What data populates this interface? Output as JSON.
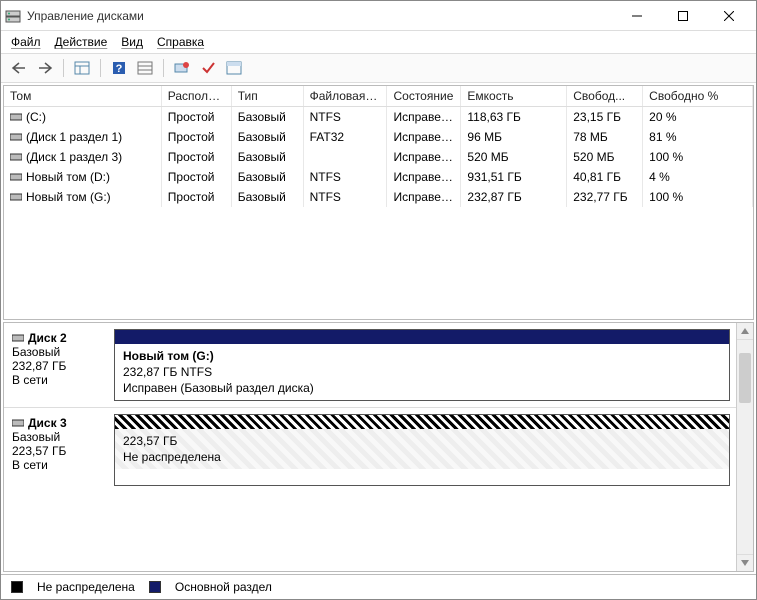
{
  "window": {
    "title": "Управление дисками"
  },
  "menu": {
    "file": "Файл",
    "action": "Действие",
    "view": "Вид",
    "help": "Справка"
  },
  "columns": {
    "volume": "Том",
    "layout": "Располож...",
    "type": "Тип",
    "fs": "Файловая с...",
    "state": "Состояние",
    "capacity": "Емкость",
    "free": "Свобод...",
    "pct": "Свободно %"
  },
  "volumes": [
    {
      "name": "(C:)",
      "layout": "Простой",
      "type": "Базовый",
      "fs": "NTFS",
      "state": "Исправен...",
      "capacity": "118,63 ГБ",
      "free": "23,15 ГБ",
      "pct": "20 %"
    },
    {
      "name": "(Диск 1 раздел 1)",
      "layout": "Простой",
      "type": "Базовый",
      "fs": "FAT32",
      "state": "Исправен...",
      "capacity": "96 МБ",
      "free": "78 МБ",
      "pct": "81 %"
    },
    {
      "name": "(Диск 1 раздел 3)",
      "layout": "Простой",
      "type": "Базовый",
      "fs": "",
      "state": "Исправен...",
      "capacity": "520 МБ",
      "free": "520 МБ",
      "pct": "100 %"
    },
    {
      "name": "Новый том (D:)",
      "layout": "Простой",
      "type": "Базовый",
      "fs": "NTFS",
      "state": "Исправен...",
      "capacity": "931,51 ГБ",
      "free": "40,81 ГБ",
      "pct": "4 %"
    },
    {
      "name": "Новый том (G:)",
      "layout": "Простой",
      "type": "Базовый",
      "fs": "NTFS",
      "state": "Исправен...",
      "capacity": "232,87 ГБ",
      "free": "232,77 ГБ",
      "pct": "100 %"
    }
  ],
  "disks": {
    "disk2": {
      "name": "Диск 2",
      "type": "Базовый",
      "size": "232,87 ГБ",
      "status": "В сети",
      "part_title": "Новый том  (G:)",
      "part_size": "232,87 ГБ NTFS",
      "part_state": "Исправен (Базовый раздел диска)"
    },
    "disk3": {
      "name": "Диск 3",
      "type": "Базовый",
      "size": "223,57 ГБ",
      "status": "В сети",
      "part_size": "223,57 ГБ",
      "part_state": "Не распределена"
    }
  },
  "legend": {
    "unallocated": "Не распределена",
    "primary": "Основной раздел"
  }
}
